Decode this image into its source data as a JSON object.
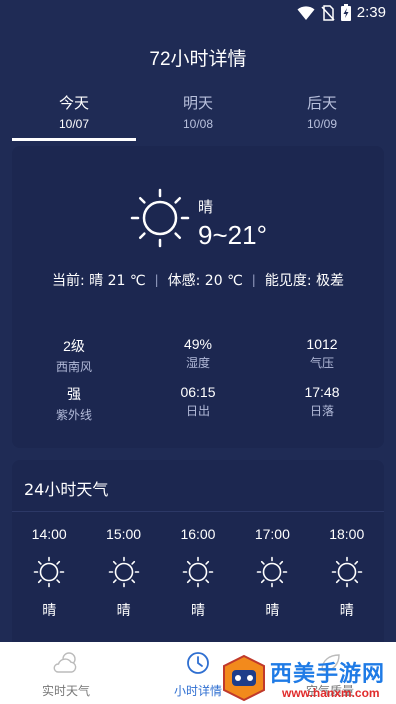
{
  "status_bar": {
    "time": "2:39"
  },
  "title": "72小时详情",
  "tabs": [
    {
      "name": "今天",
      "date": "10/07"
    },
    {
      "name": "明天",
      "date": "10/08"
    },
    {
      "name": "后天",
      "date": "10/09"
    }
  ],
  "today": {
    "condition": "晴",
    "temp_range": "9~21°",
    "current": "当前: 晴 21 ℃",
    "feels_like": "体感: 20 ℃",
    "visibility": "能见度: 极差",
    "stats": [
      {
        "value": "2级",
        "label": "西南风"
      },
      {
        "value": "49%",
        "label": "湿度"
      },
      {
        "value": "1012",
        "label": "气压"
      },
      {
        "value": "强",
        "label": "紫外线"
      },
      {
        "value": "06:15",
        "label": "日出"
      },
      {
        "value": "17:48",
        "label": "日落"
      }
    ]
  },
  "hourly": {
    "title": "24小时天气",
    "items": [
      {
        "time": "14:00",
        "condition": "晴"
      },
      {
        "time": "15:00",
        "condition": "晴"
      },
      {
        "time": "16:00",
        "condition": "晴"
      },
      {
        "time": "17:00",
        "condition": "晴"
      },
      {
        "time": "18:00",
        "condition": "晴"
      }
    ]
  },
  "bottom_nav": [
    {
      "label": "实时天气",
      "icon": "cloud-sun-icon"
    },
    {
      "label": "小时详情",
      "icon": "clock-icon"
    },
    {
      "label": "空气质量",
      "icon": "leaf-icon"
    }
  ],
  "watermark": {
    "text": "西美手游网",
    "url": "www.hanxm.com"
  },
  "colors": {
    "background": "#1f2b55",
    "card": "#1c2750",
    "accent": "#2f6fd1"
  }
}
